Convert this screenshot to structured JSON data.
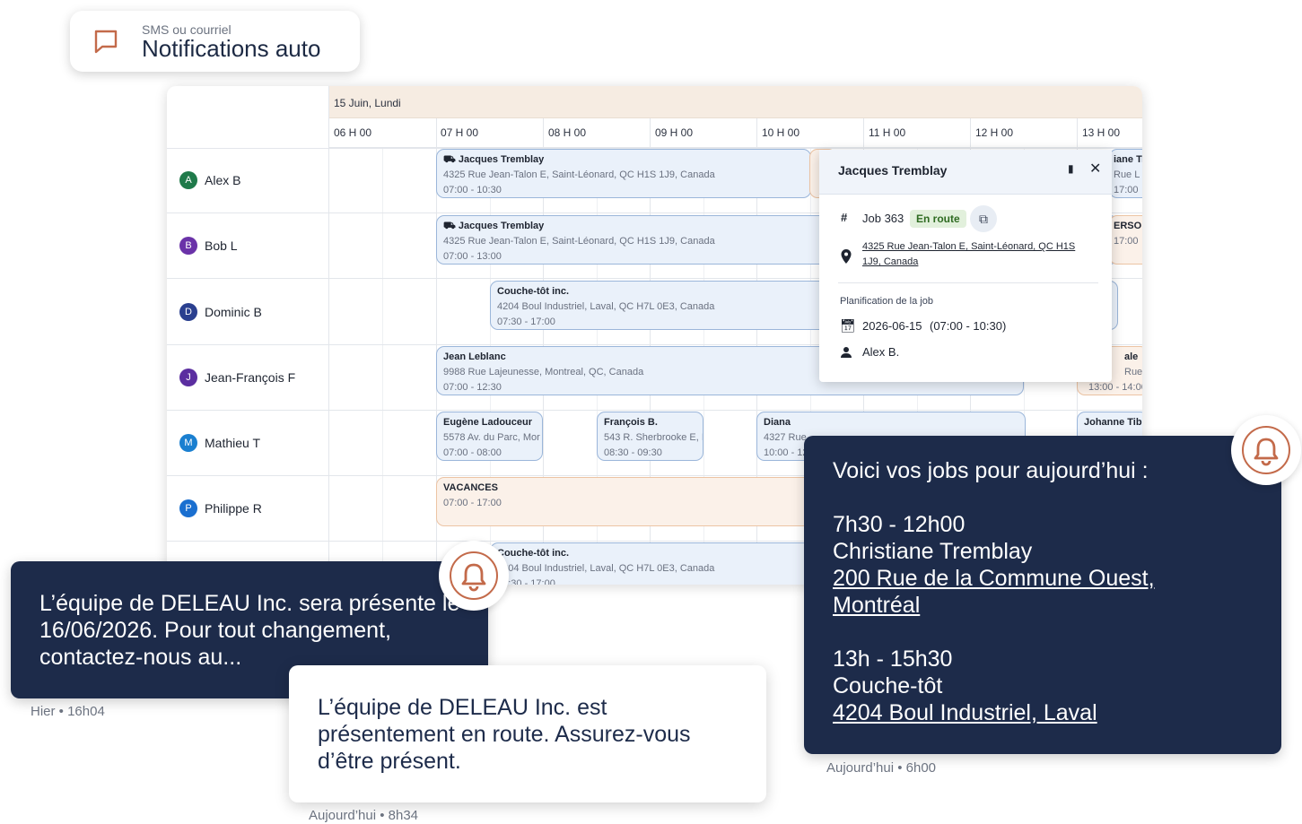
{
  "header_pill": {
    "subtitle": "SMS ou courriel",
    "title": "Notifications auto",
    "icon": "chat-bubble-icon"
  },
  "schedule": {
    "date": "15 Juin, Lundi",
    "hours": [
      "06 H 00",
      "07 H 00",
      "08 H 00",
      "09 H 00",
      "10 H 00",
      "11 H 00",
      "12 H 00",
      "13 H 00"
    ],
    "employees": [
      {
        "initial": "A",
        "name": "Alex B",
        "color": "#1f7a4a"
      },
      {
        "initial": "B",
        "name": "Bob L",
        "color": "#6a32a8"
      },
      {
        "initial": "D",
        "name": "Dominic B",
        "color": "#2a3f8f"
      },
      {
        "initial": "J",
        "name": "Jean-François F",
        "color": "#5b2ea0"
      },
      {
        "initial": "M",
        "name": "Mathieu T",
        "color": "#1a7fd0"
      },
      {
        "initial": "P",
        "name": "Philippe R",
        "color": "#1a6fd0"
      }
    ],
    "jobs": [
      {
        "title": "Jacques Tremblay",
        "address": "4325 Rue Jean-Talon E, Saint-Léonard, QC H1S 1J9, Canada",
        "time": "07:00 - 10:30"
      },
      {
        "title": "Jacques Tremblay",
        "address": "4325 Rue Jean-Talon E, Saint-Léonard, QC H1S 1J9, Canada",
        "time": "07:00 - 13:00"
      },
      {
        "title": "Couche-tôt inc.",
        "address": "4204 Boul Industriel, Laval, QC H7L 0E3, Canada",
        "time": "07:30 - 17:00"
      },
      {
        "title": "Jean Leblanc",
        "address": "9988 Rue Lajeunesse, Montreal, QC, Canada",
        "time": "07:00 - 12:30"
      },
      {
        "title": "Eugène Ladouceur",
        "address": "5578 Av. du Parc, Mor",
        "time": "07:00 - 08:00"
      },
      {
        "title": "François B.",
        "address": "543 R. Sherbrooke E, I",
        "time": "08:30 - 09:30"
      },
      {
        "title": "Diana",
        "address": "4327 Rue",
        "time": "10:00 - 12"
      },
      {
        "title": "VACANCES",
        "address": "",
        "time": "07:00 - 17:00"
      },
      {
        "title": "Couche-tôt inc.",
        "address": "4204 Boul Industriel, Laval, QC H7L 0E3, Canada",
        "time": "07:30 - 17:00"
      },
      {
        "title": "iane Tr",
        "address": "Rue L",
        "time": "17:00"
      },
      {
        "title": "ERSO",
        "address": "",
        "time": "17:00"
      },
      {
        "title": "ale",
        "address": "Rue de",
        "time": "13:00 - 14:00"
      },
      {
        "title": "Johanne Tibo",
        "address": "",
        "time": ""
      }
    ]
  },
  "popover": {
    "name": "Jacques Tremblay",
    "job_label": "Job 363",
    "status": "En route",
    "address": "4325 Rue Jean-Talon E, Saint-Léonard, QC H1S 1J9, Canada",
    "section": "Planification de la job",
    "date": "2026-06-15",
    "time": "(07:00 - 10:30)",
    "assignee": "Alex B."
  },
  "bubble_yesterday": {
    "text": "L’équipe de DELEAU Inc. sera présente le 16/06/2026. Pour tout changement, contactez-nous au...",
    "timestamp": "Hier • 16h04"
  },
  "bubble_enroute": {
    "text": "L’équipe de DELEAU Inc. est présentement en route. Assurez-vous d’être présent.",
    "timestamp": "Aujourd’hui • 8h34"
  },
  "bubble_daily": {
    "intro": "Voici vos jobs pour aujourd’hui :",
    "job1_time": "7h30 - 12h00",
    "job1_client": "Christiane Tremblay",
    "job1_address_1": "200 Rue de la Commune Ouest,",
    "job1_address_2": "Montréal",
    "job2_time": "13h - 15h30",
    "job2_client": "Couche-tôt",
    "job2_address": "4204 Boul Industriel, Laval",
    "timestamp": "Aujourd’hui • 6h00"
  },
  "colors": {
    "accent": "#c36a4a",
    "navy": "#1d2b4a"
  }
}
